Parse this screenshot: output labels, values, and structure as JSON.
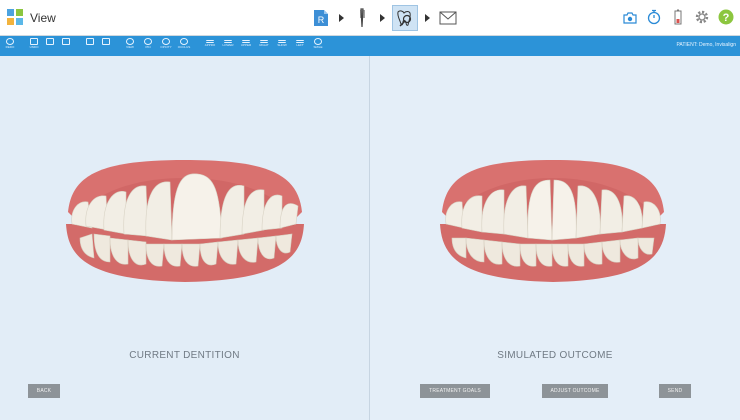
{
  "app": {
    "title": "View",
    "logo_colors": [
      "#4ca3e0",
      "#8cc63f",
      "#f2b33d",
      "#5bb8e8"
    ]
  },
  "workflow": {
    "steps": [
      {
        "name": "records-icon",
        "label": "R"
      },
      {
        "name": "toothbrush-icon"
      },
      {
        "name": "tooth-search-icon",
        "active": true
      },
      {
        "name": "envelope-icon"
      }
    ]
  },
  "top_right_icons": [
    "camera-icon",
    "timer-icon",
    "battery-icon",
    "gear-icon",
    "help-icon"
  ],
  "toolbar": {
    "items": [
      "REDO",
      "UNDO",
      "VIEW",
      "PIN",
      "OPCITY",
      "OCCLUS",
      "APPRO",
      "LOWER",
      "UPPER",
      "RIGHT",
      "SHOW",
      "LEFT",
      "SMILE"
    ],
    "patient": "PATIENT: Demo, Invisalign"
  },
  "left_panel": {
    "label": "CURRENT DENTITION",
    "back_button": "BACK"
  },
  "right_panel": {
    "label": "SIMULATED OUTCOME",
    "buttons": {
      "treatment_goals": "TREATMENT GOALS",
      "adjust_outcome": "ADJUST OUTCOME",
      "send": "SEND"
    }
  },
  "colors": {
    "toolbar": "#2c93d8",
    "gum": "#d9716f",
    "tooth": "#f3efe6",
    "button": "#8d9398",
    "help": "#8cc63f"
  }
}
